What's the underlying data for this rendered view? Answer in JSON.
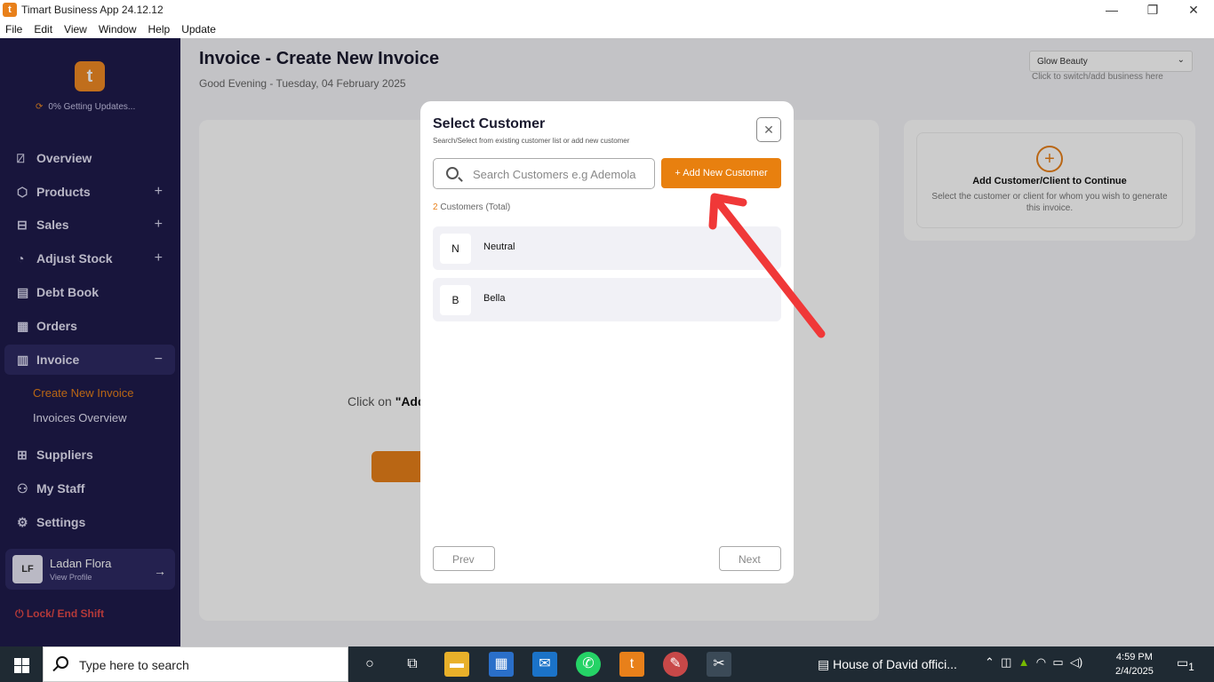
{
  "window": {
    "title": "Timart Business App 24.12.12",
    "icon_letter": "t",
    "menu": [
      "File",
      "Edit",
      "View",
      "Window",
      "Help",
      "Update"
    ],
    "controls": {
      "minimize": "—",
      "restore": "❐",
      "close": "✕"
    }
  },
  "sidebar": {
    "logo_letter": "t",
    "update_status": "0%  Getting Updates...",
    "items": [
      {
        "label": "Overview",
        "icon": "chart-icon"
      },
      {
        "label": "Products",
        "icon": "box-icon"
      },
      {
        "label": "Sales",
        "icon": "cart-icon"
      },
      {
        "label": "Adjust Stock",
        "icon": "pie-icon"
      },
      {
        "label": "Debt Book",
        "icon": "book-icon"
      },
      {
        "label": "Orders",
        "icon": "orders-icon"
      },
      {
        "label": "Invoice",
        "icon": "invoice-icon"
      },
      {
        "label": "Suppliers",
        "icon": "suppliers-icon"
      },
      {
        "label": "My Staff",
        "icon": "staff-icon"
      },
      {
        "label": "Settings",
        "icon": "gear-icon"
      }
    ],
    "invoice_sub": [
      "Create New Invoice",
      "Invoices Overview"
    ],
    "profile": {
      "initials": "LF",
      "name": "Ladan Flora",
      "link": "View Profile"
    },
    "lock": "Lock/ End Shift",
    "colors": {
      "bg": "#1e1b4b",
      "accent": "#e8801a"
    }
  },
  "header": {
    "title": "Invoice - Create New Invoice",
    "greeting": "Good Evening - Tuesday, 04 February 2025",
    "business_select": "Glow Beauty",
    "business_hint": "Click to switch/add business here"
  },
  "main": {
    "click_on_prefix": "Click on ",
    "click_on_bold": "\"Add",
    "right_card": {
      "heading": "Add Customer/Client to Continue",
      "text": "Select the customer or client for whom you wish to generate this invoice."
    }
  },
  "modal": {
    "title": "Select Customer",
    "subtitle": "Search/Select from existing customer list or add new customer",
    "search_placeholder": "Search Customers e.g Ademola",
    "add_button": "+ Add New Customer",
    "count_num": "2",
    "count_label": " Customers (Total)",
    "customers": [
      {
        "initial": "N",
        "name": "Neutral"
      },
      {
        "initial": "B",
        "name": "Bella"
      }
    ],
    "prev": "Prev",
    "next": "Next"
  },
  "taskbar": {
    "search_text": "Type here to search",
    "news": "House of David offici...",
    "time": "4:59 PM",
    "date": "2/4/2025",
    "notif_count": "1"
  }
}
